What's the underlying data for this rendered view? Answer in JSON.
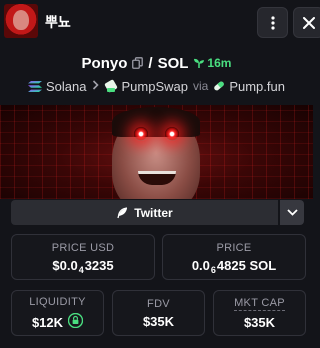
{
  "header": {
    "token_name": "뿌뇨",
    "menu_icon": "kebab-menu-icon",
    "close_icon": "close-icon"
  },
  "pair": {
    "base": "Ponyo",
    "separator": "/",
    "quote": "SOL",
    "age": "16m",
    "copy_icon": "copy-icon",
    "age_icon": "seedling-icon"
  },
  "chain": {
    "network": "Solana",
    "dex": "PumpSwap",
    "via_label": "via",
    "launchpad": "Pump.fun"
  },
  "social": {
    "twitter_label": "Twitter",
    "expand_icon": "chevron-down-icon"
  },
  "stats": {
    "price_usd": {
      "label": "PRICE USD",
      "prefix": "$0.0",
      "zeros": "4",
      "digits": "3235"
    },
    "price_sol": {
      "label": "PRICE",
      "prefix": "0.0",
      "zeros": "6",
      "digits": "4825 SOL"
    },
    "liquidity": {
      "label": "LIQUIDITY",
      "value": "$12K"
    },
    "fdv": {
      "label": "FDV",
      "value": "$35K"
    },
    "mkt_cap": {
      "label": "MKT CAP",
      "value": "$35K"
    }
  },
  "colors": {
    "background": "#131419",
    "accent_green": "#4ade80",
    "box_border": "#303139"
  }
}
